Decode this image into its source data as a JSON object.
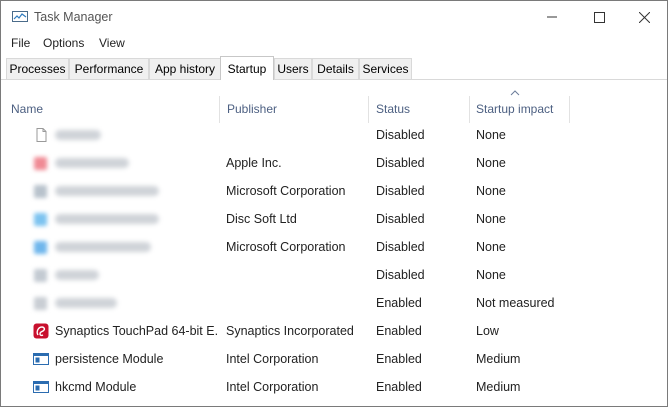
{
  "window": {
    "title": "Task Manager",
    "icon": "task-manager-icon"
  },
  "menu": {
    "file": "File",
    "options": "Options",
    "view": "View"
  },
  "tabs": [
    {
      "label": "Processes"
    },
    {
      "label": "Performance"
    },
    {
      "label": "App history"
    },
    {
      "label": "Startup",
      "active": true
    },
    {
      "label": "Users"
    },
    {
      "label": "Details"
    },
    {
      "label": "Services"
    }
  ],
  "columns": {
    "name": "Name",
    "publisher": "Publisher",
    "status": "Status",
    "impact": "Startup impact",
    "sorted_by": "Startup impact"
  },
  "rows": [
    {
      "name": "",
      "name_obscured": true,
      "publisher": "",
      "status": "Disabled",
      "impact": "None",
      "icon": "blank-file-icon"
    },
    {
      "name": "",
      "name_obscured": true,
      "publisher": "Apple Inc.",
      "status": "Disabled",
      "impact": "None",
      "icon": "red-app-icon"
    },
    {
      "name": "",
      "name_obscured": true,
      "publisher": "Microsoft Corporation",
      "status": "Disabled",
      "impact": "None",
      "icon": "gray-app-icon"
    },
    {
      "name": "",
      "name_obscured": true,
      "publisher": "Disc Soft Ltd",
      "status": "Disabled",
      "impact": "None",
      "icon": "blue-app-icon"
    },
    {
      "name": "",
      "name_obscured": true,
      "publisher": "Microsoft Corporation",
      "status": "Disabled",
      "impact": "None",
      "icon": "blue-app-icon"
    },
    {
      "name": "",
      "name_obscured": true,
      "publisher": "",
      "status": "Disabled",
      "impact": "None",
      "icon": "gray-app-icon"
    },
    {
      "name": "",
      "name_obscured": true,
      "publisher": "",
      "status": "Enabled",
      "impact": "Not measured",
      "icon": "gray-app-icon"
    },
    {
      "name": "Synaptics TouchPad 64-bit E...",
      "publisher": "Synaptics Incorporated",
      "status": "Enabled",
      "impact": "Low",
      "icon": "synaptics-icon"
    },
    {
      "name": "persistence Module",
      "publisher": "Intel Corporation",
      "status": "Enabled",
      "impact": "Medium",
      "icon": "module-window-icon"
    },
    {
      "name": "hkcmd Module",
      "publisher": "Intel Corporation",
      "status": "Enabled",
      "impact": "Medium",
      "icon": "module-window-icon"
    }
  ],
  "colors": {
    "header_text": "#4d6082",
    "synaptics_red": "#c8102e",
    "module_blue": "#2b6cb0"
  }
}
